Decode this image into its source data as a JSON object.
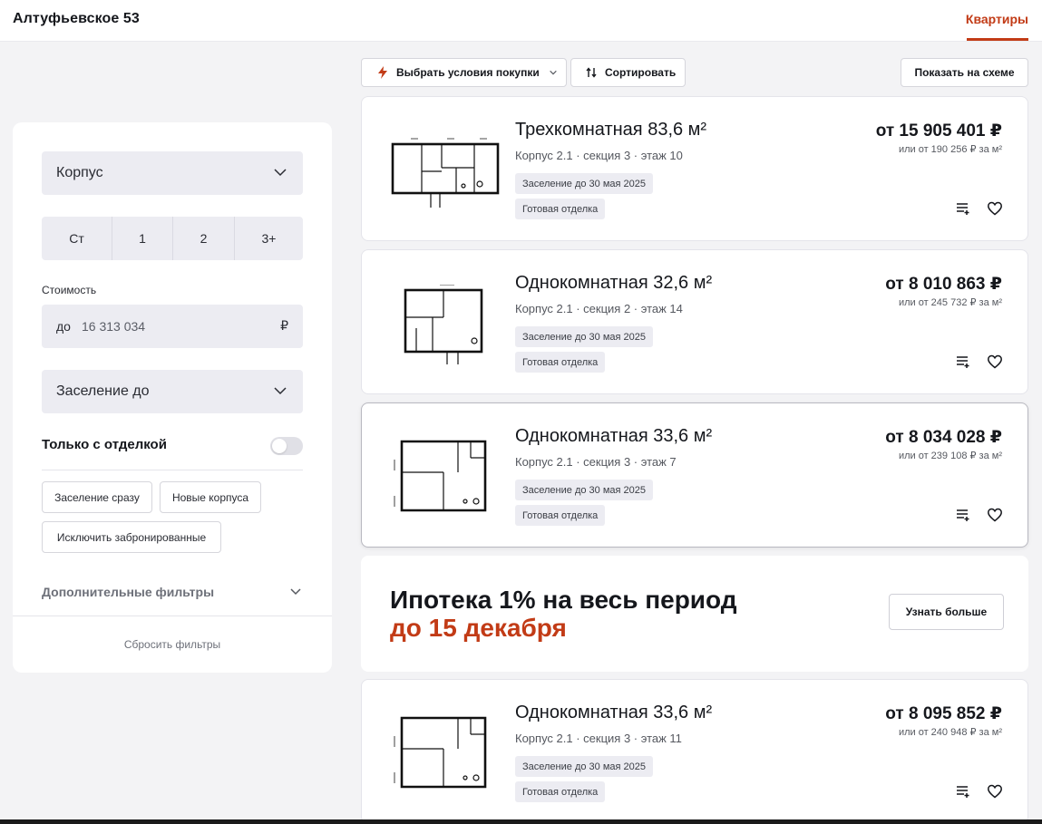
{
  "header": {
    "title": "Алтуфьевское 53",
    "nav_active": "Квартиры"
  },
  "filters": {
    "building_select": "Корпус",
    "rooms": [
      "Ст",
      "1",
      "2",
      "3+"
    ],
    "cost_label": "Стоимость",
    "price_prefix": "до",
    "price_value": "16 313 034",
    "price_currency": "₽",
    "move_in_select": "Заселение до",
    "finish_only_label": "Только с отделкой",
    "finish_only_on": false,
    "chips": [
      "Заселение сразу",
      "Новые корпуса",
      "Исключить забронированные"
    ],
    "more_filters": "Дополнительные фильтры",
    "reset": "Сбросить фильтры"
  },
  "toolbar": {
    "conditions": "Выбрать условия покупки",
    "sort": "Сортировать",
    "scheme": "Показать на схеме"
  },
  "listings": [
    {
      "name": "Трехкомнатная 83,6 м²",
      "location": "Корпус 2.1 · секция 3 · этаж 10",
      "tags": [
        "Заселение до 30 мая 2025",
        "Готовая отделка"
      ],
      "price": "от 15 905 401 ₽",
      "price_per_m": "или от 190 256 ₽ за м²"
    },
    {
      "name": "Однокомнатная 32,6 м²",
      "location": "Корпус 2.1 · секция 2 · этаж 14",
      "tags": [
        "Заселение до 30 мая 2025",
        "Готовая отделка"
      ],
      "price": "от 8 010 863 ₽",
      "price_per_m": "или от 245 732 ₽ за м²"
    },
    {
      "name": "Однокомнатная 33,6 м²",
      "location": "Корпус 2.1 · секция 3 · этаж 7",
      "tags": [
        "Заселение до 30 мая 2025",
        "Готовая отделка"
      ],
      "price": "от 8 034 028 ₽",
      "price_per_m": "или от 239 108 ₽ за м²"
    },
    {
      "name": "Однокомнатная 33,6 м²",
      "location": "Корпус 2.1 · секция 3 · этаж 11",
      "tags": [
        "Заселение до 30 мая 2025",
        "Готовая отделка"
      ],
      "price": "от 8 095 852 ₽",
      "price_per_m": "или от 240 948 ₽ за м²"
    }
  ],
  "promo": {
    "line1": "Ипотека 1% на весь период",
    "line2": "до 15 декабря",
    "button": "Узнать больше"
  },
  "icons": {
    "conditions": "lightning-icon",
    "sort": "sort-icon",
    "compare": "compare-list-icon",
    "favorite": "heart-icon",
    "chevron": "chevron-down-icon"
  },
  "colors": {
    "accent": "#c23b16",
    "panel": "#ececf2",
    "background": "#f3f3f5"
  }
}
